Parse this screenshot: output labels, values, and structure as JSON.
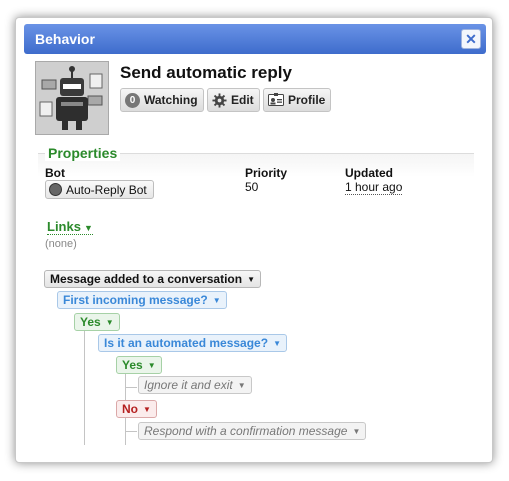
{
  "window": {
    "title": "Behavior",
    "close_label": "✕"
  },
  "header": {
    "title": "Send automatic reply",
    "watching_count": "0",
    "watching_label": "Watching",
    "edit_label": "Edit",
    "profile_label": "Profile"
  },
  "properties": {
    "section_title": "Properties",
    "bot_label": "Bot",
    "bot_value": "Auto-Reply Bot",
    "priority_label": "Priority",
    "priority_value": "50",
    "updated_label": "Updated",
    "updated_value": "1 hour ago"
  },
  "links": {
    "title": "Links",
    "empty_text": "(none)"
  },
  "rules": {
    "trigger": "Message added to a conversation",
    "condition1": "First incoming message?",
    "condition1_yes": "Yes",
    "condition2": "Is it an automated message?",
    "condition2_yes": "Yes",
    "action_yes": "Ignore it and exit",
    "condition2_no": "No",
    "action_no": "Respond with a confirmation message"
  },
  "colors": {
    "titlebar": "#4d79d8",
    "section_green": "#2b8a2b",
    "question_blue": "#3a88d8",
    "no_red": "#b52020"
  }
}
